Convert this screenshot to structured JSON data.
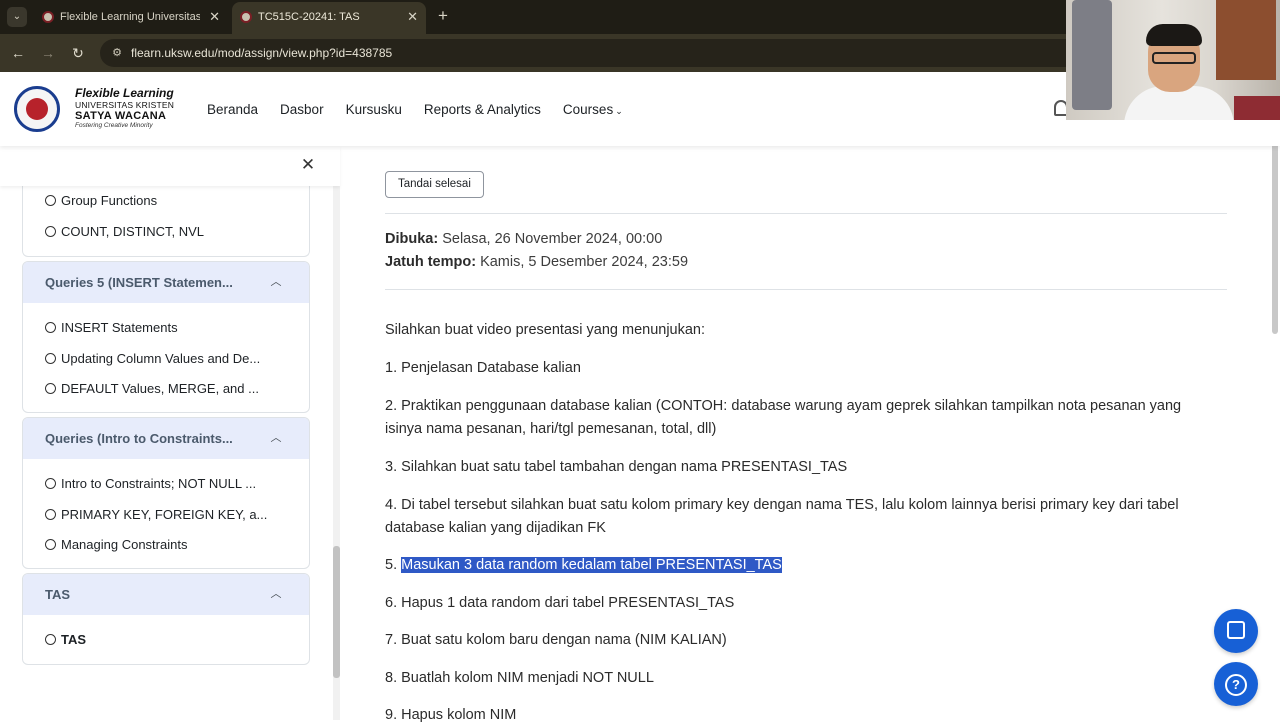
{
  "browser": {
    "tabs": [
      {
        "label": "Flexible Learning Universitas Kr",
        "active": false
      },
      {
        "label": "TC515C-20241: TAS",
        "active": true
      }
    ],
    "url": "flearn.uksw.edu/mod/assign/view.php?id=438785"
  },
  "site": {
    "brand": {
      "line1": "Flexible Learning",
      "line2": "UNIVERSITAS KRISTEN",
      "line3": "SATYA WACANA",
      "line4": "Fostering Creative Minority"
    },
    "nav": [
      "Beranda",
      "Dasbor",
      "Kursusku",
      "Reports & Analytics",
      "Courses"
    ]
  },
  "drawer": {
    "partial_items": [
      "Group Functions",
      "COUNT, DISTINCT, NVL"
    ],
    "sections": [
      {
        "title": "Queries 5 (INSERT Statemen...",
        "items": [
          "INSERT Statements",
          "Updating Column Values and De...",
          "DEFAULT Values, MERGE, and ..."
        ]
      },
      {
        "title": "Queries (Intro to Constraints...",
        "items": [
          "Intro to Constraints; NOT NULL ...",
          "PRIMARY KEY, FOREIGN KEY, a...",
          "Managing Constraints"
        ]
      },
      {
        "title": "TAS",
        "items": [
          "TAS"
        ]
      }
    ]
  },
  "main": {
    "mark_done_label": "Tandai selesai",
    "opened_label": "Dibuka:",
    "opened_value": "Selasa, 26 November 2024, 00:00",
    "due_label": "Jatuh tempo:",
    "due_value": "Kamis, 5 Desember 2024, 23:59",
    "intro": "Silahkan buat video presentasi yang menunjukan:",
    "steps": [
      "1. Penjelasan Database kalian",
      "2. Praktikan penggunaan database kalian (CONTOH: database warung ayam geprek silahkan tampilkan nota pesanan yang isinya nama pesanan, hari/tgl pemesanan, total, dll)",
      "3. Silahkan buat satu tabel tambahan dengan nama PRESENTASI_TAS",
      "4. Di tabel tersebut silahkan buat satu kolom primary key dengan nama TES, lalu kolom lainnya berisi primary key dari tabel database kalian yang dijadikan FK",
      "Masukan 3 data random kedalam tabel PRESENTASI_TAS",
      "6. Hapus 1 data random dari tabel PRESENTASI_TAS",
      "7. Buat satu kolom baru dengan nama (NIM KALIAN)",
      "8. Buatlah kolom NIM menjadi NOT NULL",
      "9. Hapus kolom NIM"
    ],
    "step5_prefix": "5."
  },
  "colors": {
    "accent": "#1760d6",
    "section_header_bg": "#e7ecfb",
    "selection_highlight": "#2f59c6",
    "tab_bar_bg": "#1f1d15"
  }
}
